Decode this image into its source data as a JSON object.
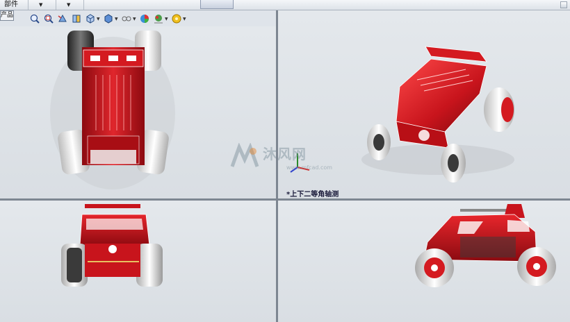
{
  "toolbar": {
    "menu_label": "部件",
    "product_tag": "产品"
  },
  "viewports": {
    "top_right_label": "*上下二等角轴测"
  },
  "watermark": {
    "text": "沐风网",
    "sub": "www.mfcad.com"
  },
  "icons": [
    "zoom-to-fit-icon",
    "zoom-area-icon",
    "previous-view-icon",
    "section-view-icon",
    "view-orientation-icon",
    "display-style-icon",
    "hide-show-icon",
    "edit-appearance-icon",
    "apply-scene-icon",
    "view-settings-icon"
  ],
  "colors": {
    "body_red": "#c8141c",
    "tire_white": "#f2f2f2",
    "tire_dark": "#3a3a3a"
  }
}
